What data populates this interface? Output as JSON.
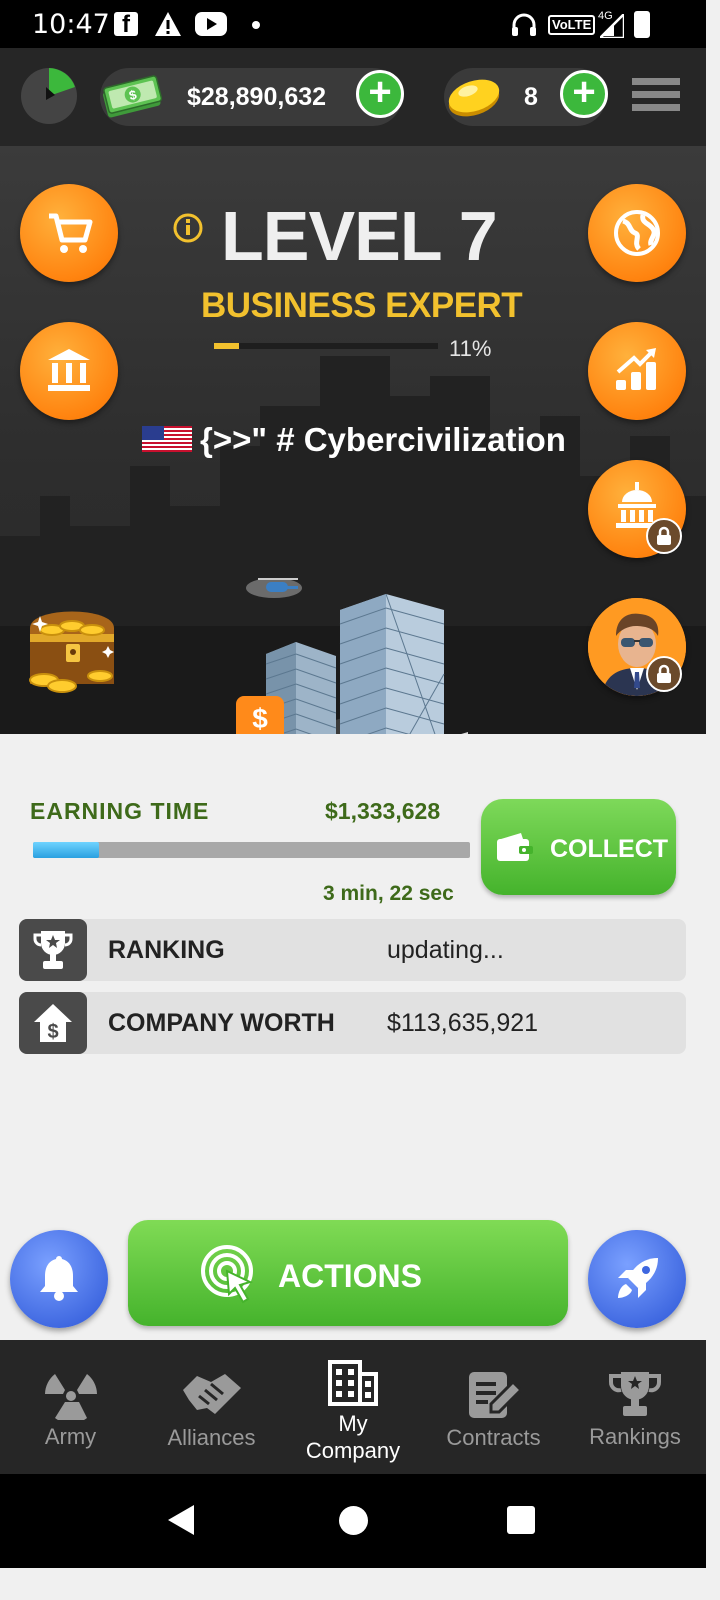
{
  "status_bar": {
    "time": "10:47",
    "volte": "VoLTE",
    "network": "4G"
  },
  "top_bar": {
    "money": "$28,890,632",
    "gold": "8"
  },
  "level": {
    "title": "LEVEL 7",
    "rank_title": "BUSINESS EXPERT",
    "progress_text": "11%",
    "progress_value": 0.11
  },
  "company": {
    "name": "{>>\" # Cybercivilization"
  },
  "earning": {
    "label": "EARNING TIME",
    "amount": "$1,333,628",
    "time_left": "3 min, 22 sec",
    "progress_value": 0.15
  },
  "collect_label": "COLLECT",
  "info_rows": [
    {
      "label": "RANKING",
      "value": "updating..."
    },
    {
      "label": "COMPANY WORTH",
      "value": "$113,635,921"
    }
  ],
  "actions_label": "ACTIONS",
  "bottom_nav": [
    {
      "label": "Army",
      "active": false
    },
    {
      "label": "Alliances",
      "active": false
    },
    {
      "label": "My Company",
      "active": true
    },
    {
      "label": "Contracts",
      "active": false
    },
    {
      "label": "Rankings",
      "active": false
    }
  ],
  "colors": {
    "accent_orange": "#ff8a1a",
    "accent_green": "#5cc43a",
    "gold_text": "#f2c12e",
    "earning_text": "#3e6a1a"
  }
}
